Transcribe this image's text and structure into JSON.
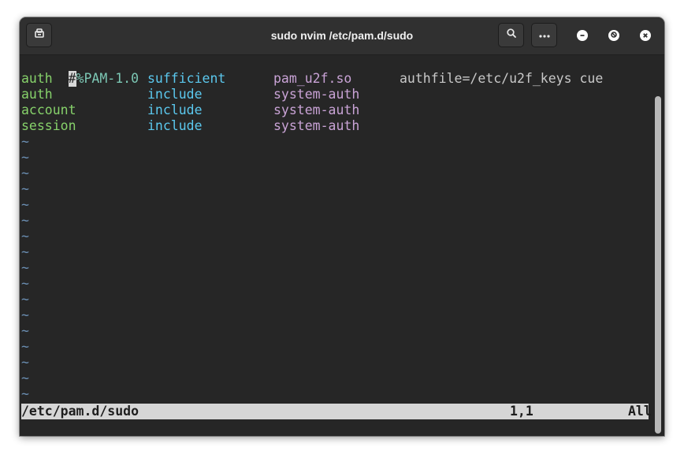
{
  "window": {
    "title": "sudo nvim /etc/pam.d/sudo"
  },
  "icons": {
    "new_tab": "terminal-tab-icon",
    "search": "search-icon",
    "menu": "more-dots-icon",
    "minimize": "minimize-icon",
    "maximize": "maximize-icon",
    "close": "close-icon"
  },
  "editor": {
    "header": {
      "cursor_char": "#",
      "rest": "%PAM-1.0"
    },
    "rows": [
      {
        "type": "auth",
        "control": "sufficient",
        "module": "pam_u2f.so",
        "args": "authfile=/etc/u2f_keys cue"
      },
      {
        "type": "auth",
        "control": "include",
        "module": "system-auth",
        "args": ""
      },
      {
        "type": "account",
        "control": "include",
        "module": "system-auth",
        "args": ""
      },
      {
        "type": "session",
        "control": "include",
        "module": "system-auth",
        "args": ""
      }
    ],
    "tilde": "~",
    "empty_line_count": 17
  },
  "statusline": {
    "filename": "/etc/pam.d/sudo",
    "position": "1,1",
    "scroll": "All"
  },
  "colors": {
    "keyword": "#86d16a",
    "control": "#5bc8ee",
    "module": "#c9a3d6",
    "args": "#c8c8c8",
    "comment": "#7cc7b4",
    "tilde": "#6b8fb4",
    "background": "#262626",
    "statusline_bg": "#d6d6d6"
  }
}
